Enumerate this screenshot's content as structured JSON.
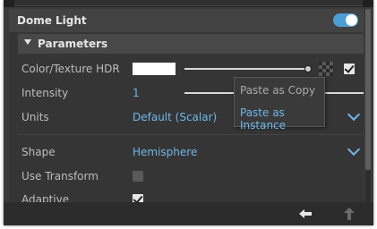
{
  "panel": {
    "title": "Dome Light",
    "enabled": true,
    "accent": "#4c9fd6"
  },
  "section": {
    "label": "Parameters",
    "expanded": true
  },
  "rows": {
    "color_texture": {
      "label": "Color/Texture HDR",
      "swatch_color": "#ffffff",
      "checked": true
    },
    "intensity": {
      "label": "Intensity",
      "value": "1"
    },
    "units": {
      "label": "Units",
      "value": "Default (Scalar)"
    },
    "shape": {
      "label": "Shape",
      "value": "Hemisphere"
    },
    "use_transform": {
      "label": "Use Transform",
      "checked": false
    },
    "adaptive": {
      "label": "Adaptive",
      "checked": true
    }
  },
  "context_menu": {
    "items": [
      {
        "label": "Paste as Copy",
        "enabled": false
      },
      {
        "label": "Paste as Instance",
        "enabled": true
      }
    ]
  },
  "footer": {
    "icons": [
      "back-arrow-icon",
      "up-arrow-icon"
    ]
  }
}
